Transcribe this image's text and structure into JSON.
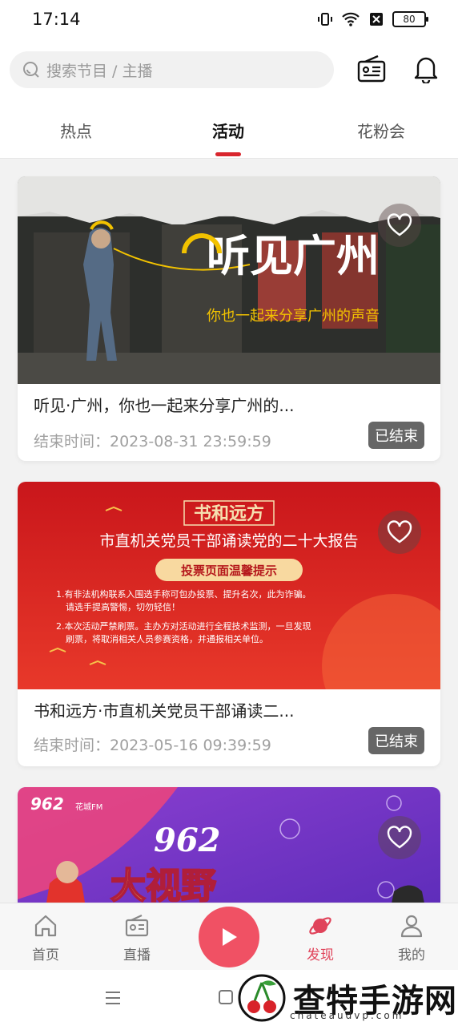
{
  "status": {
    "time": "17:14",
    "battery": "80"
  },
  "search": {
    "placeholder": "搜索节目 / 主播"
  },
  "tabs": [
    {
      "label": "热点"
    },
    {
      "label": "活动"
    },
    {
      "label": "花粉会"
    }
  ],
  "cards": [
    {
      "title": "听见·广州，你也一起来分享广州的...",
      "end_time": "结束时间：2023-08-31 23:59:59",
      "status": "已结束",
      "banner": {
        "headline": "听见广州",
        "subline": "你也一起来分享广州的声音"
      }
    },
    {
      "title": "书和远方·市直机关党员干部诵读二...",
      "end_time": "结束时间：2023-05-16 09:39:59",
      "status": "已结束",
      "banner": {
        "headline": "书和远方",
        "subline": "市直机关党员干部诵读党的二十大报告",
        "notice_title": "投票页面温馨提示",
        "notice_1": "1.有非法机构联系入围选手称可包办投票、提升名次，此为诈骗。",
        "notice_1b": "请选手提高警惕，切勿轻信！",
        "notice_2": "2.本次活动严禁刷票。主办方对活动进行全程技术监测，一旦发现",
        "notice_2b": "刷票，将取消相关人员参赛资格，并通报相关单位。"
      }
    },
    {
      "banner": {
        "logo": "962",
        "brand": "花城FM",
        "headline": "大视野"
      }
    }
  ],
  "bottom_nav": [
    {
      "label": "首页"
    },
    {
      "label": "直播"
    },
    {
      "label": "发现"
    },
    {
      "label": "我的"
    }
  ],
  "watermark": {
    "text": "查特手游网",
    "sub": "chateaudvp.com"
  },
  "colors": {
    "accent": "#d9262e",
    "nav_active": "#e0435a",
    "play": "#f05164"
  }
}
